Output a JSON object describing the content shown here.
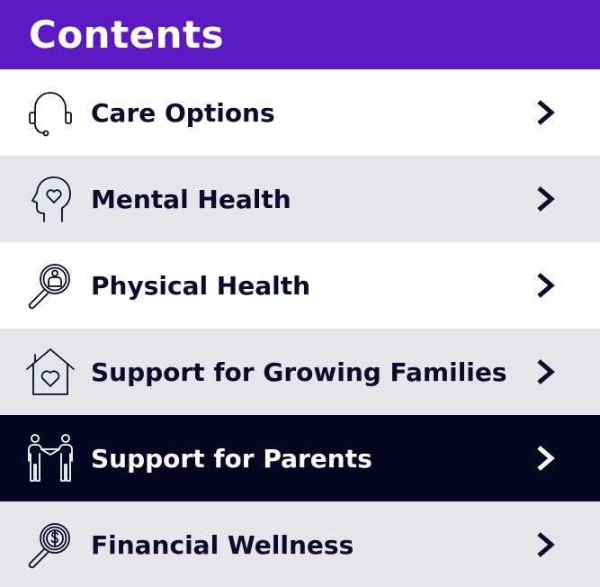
{
  "header": {
    "title": "Contents"
  },
  "colors": {
    "header_bg": "#5b1ac4",
    "row_gray": "#e5e5ea",
    "row_active": "#070722",
    "text": "#0b0b2b"
  },
  "menu": {
    "items": [
      {
        "label": "Care Options",
        "icon": "headset-icon"
      },
      {
        "label": "Mental Health",
        "icon": "head-heart-icon"
      },
      {
        "label": "Physical Health",
        "icon": "magnifier-person-icon"
      },
      {
        "label": "Support for Growing Families",
        "icon": "house-heart-icon"
      },
      {
        "label": "Support for Parents",
        "icon": "people-holding-hands-icon"
      },
      {
        "label": "Financial Wellness",
        "icon": "magnifier-dollar-icon"
      }
    ]
  }
}
